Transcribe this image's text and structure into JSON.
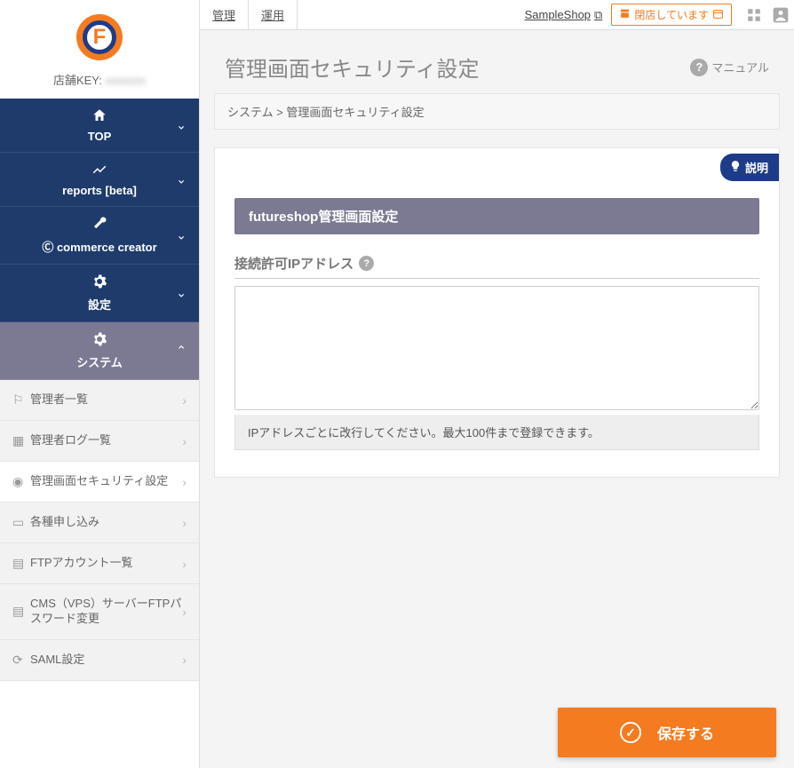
{
  "sidebar": {
    "shop_key_label": "店舗KEY:",
    "shop_key_value": "xxxxxxx",
    "groups": [
      {
        "icon": "🏠",
        "label": "TOP"
      },
      {
        "icon": "📈",
        "label": "reports [beta]"
      },
      {
        "icon_svg": "wrench",
        "label": "commerce creator",
        "prefix_icon": "Ⓒ"
      },
      {
        "icon": "⚙",
        "label": "設定"
      },
      {
        "icon": "⚙",
        "label": "システム",
        "active": true
      }
    ],
    "subitems": [
      {
        "icon": "👥",
        "label": "管理者一覧"
      },
      {
        "icon": "▦",
        "label": "管理者ログ一覧"
      },
      {
        "icon": "🛡",
        "label": "管理画面セキュリティ設定",
        "current": true
      },
      {
        "icon": "⬚",
        "label": "各種申し込み"
      },
      {
        "icon": "🖳",
        "label": "FTPアカウント一覧"
      },
      {
        "icon": "🖳",
        "label": "CMS（VPS）サーバーFTPパスワード変更"
      },
      {
        "icon": "⟳",
        "label": "SAML設定"
      }
    ]
  },
  "topbar": {
    "tabs": [
      "管理",
      "運用"
    ],
    "shop_link": "SampleShop",
    "status": "閉店しています"
  },
  "page": {
    "title": "管理画面セキュリティ設定",
    "manual": "マニュアル",
    "breadcrumb": "システム > 管理画面セキュリティ設定",
    "explain": "説明",
    "section_title": "futureshop管理画面設定",
    "field_label": "接続許可IPアドレス",
    "ip_value": "",
    "helper": "IPアドレスごとに改行してください。最大100件まで登録できます。",
    "save": "保存する"
  }
}
